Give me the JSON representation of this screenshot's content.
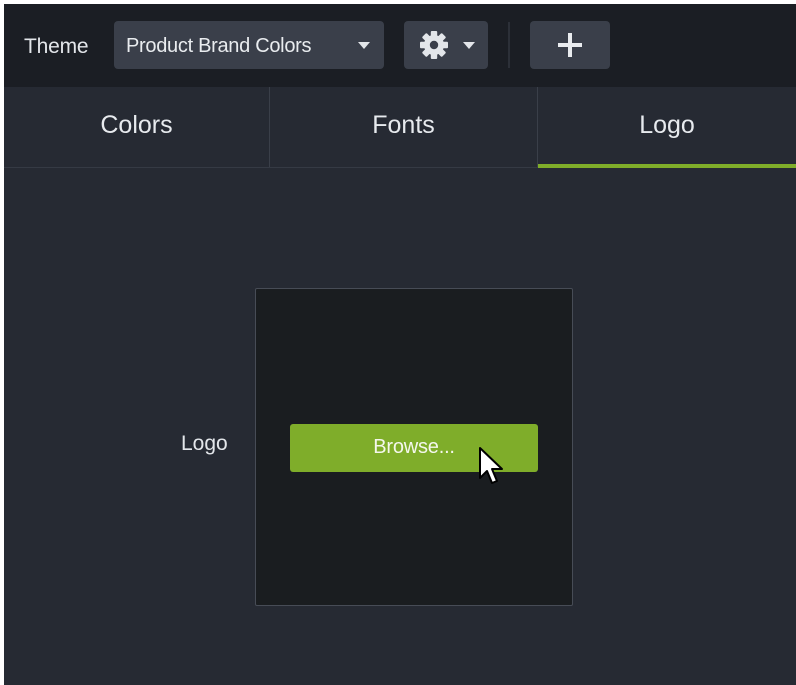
{
  "toolbar": {
    "theme_label": "Theme",
    "theme_select": {
      "value": "Product Brand Colors",
      "icon": "chevron-down-icon"
    },
    "settings_button": {
      "icon": "gear-icon",
      "dropdown_icon": "chevron-down-icon"
    },
    "add_button": {
      "icon": "plus-icon"
    }
  },
  "tabs": [
    {
      "label": "Colors",
      "active": false
    },
    {
      "label": "Fonts",
      "active": false
    },
    {
      "label": "Logo",
      "active": true
    }
  ],
  "logo_section": {
    "label": "Logo",
    "browse_label": "Browse..."
  },
  "colors": {
    "accent": "#7fad2a",
    "panel_bg": "#262a33",
    "toolbar_bg": "#1b1e24",
    "control_bg": "#3a3f4a",
    "well_bg": "#1a1d20"
  }
}
